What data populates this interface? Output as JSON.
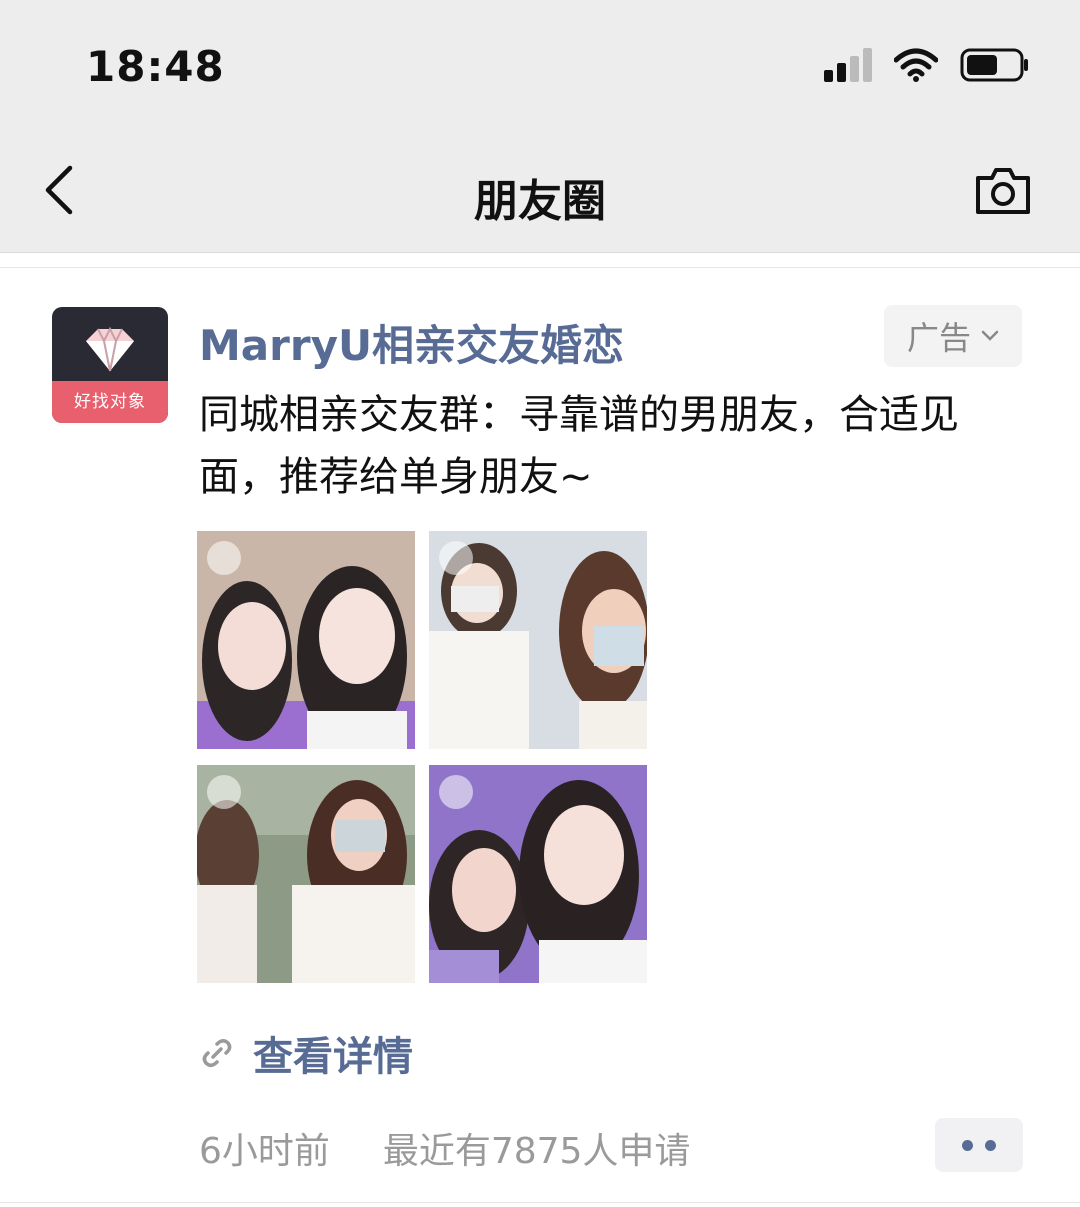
{
  "status_bar": {
    "time": "18:48"
  },
  "nav": {
    "title": "朋友圈"
  },
  "post": {
    "author": "MarryU相亲交友婚恋",
    "avatar_band_text": "好找对象",
    "ad_label": "广告",
    "text": "同城相亲交友群：寻靠谱的男朋友，合适见面，推荐给单身朋友~",
    "details_label": "查看详情",
    "time_ago": "6小时前",
    "applicants_text": "最近有7875人申请"
  },
  "colors": {
    "link": "#576b95",
    "nav_bg": "#ededed",
    "brand_pink": "#e8606e"
  }
}
